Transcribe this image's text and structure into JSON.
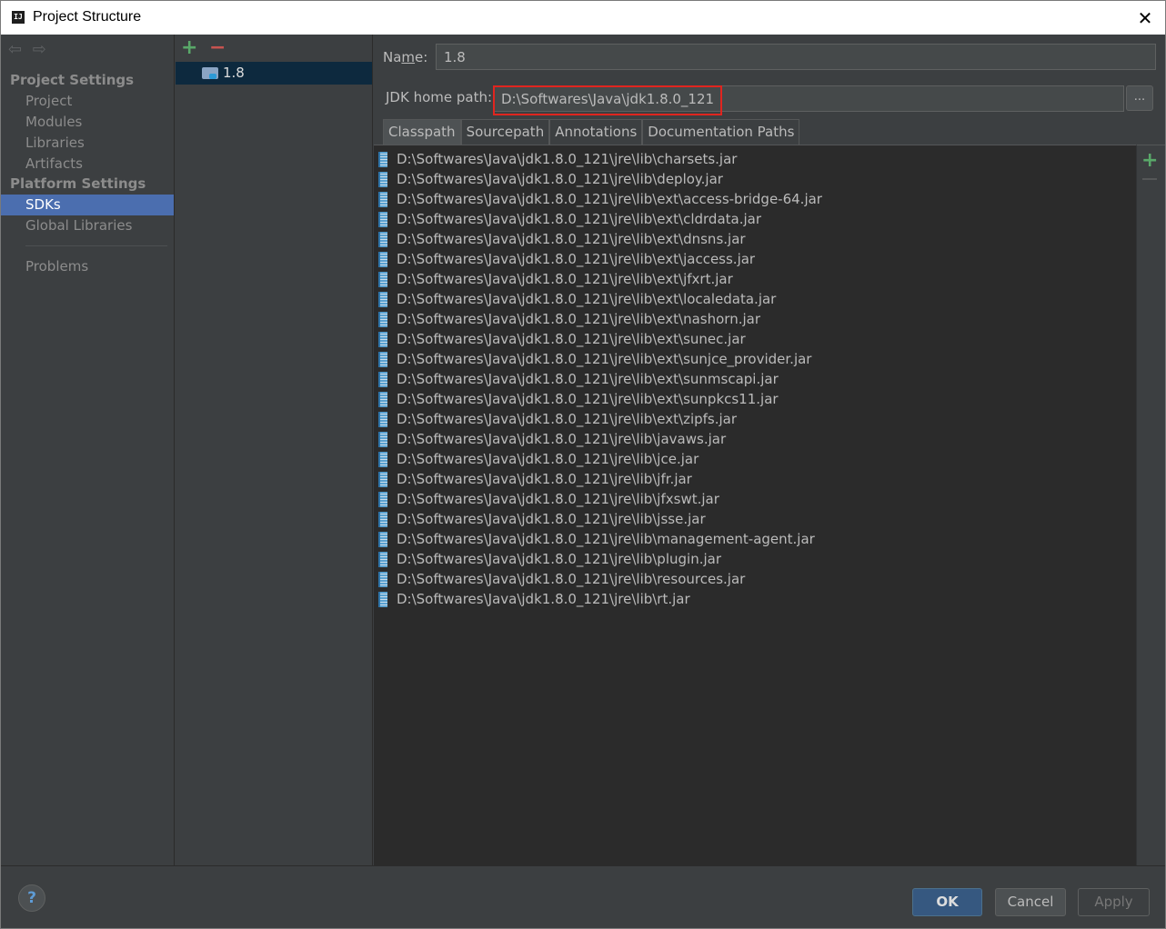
{
  "window": {
    "title": "Project Structure",
    "close_icon": "✕"
  },
  "nav": {
    "back_icon": "⇦",
    "forward_icon": "⇨",
    "sections": [
      {
        "label": "Project Settings",
        "items": [
          "Project",
          "Modules",
          "Libraries",
          "Artifacts"
        ]
      },
      {
        "label": "Platform Settings",
        "items": [
          "SDKs",
          "Global Libraries"
        ]
      }
    ],
    "problems": "Problems",
    "selected": "SDKs"
  },
  "sdk_list": {
    "add_icon": "+",
    "remove_icon": "−",
    "items": [
      "1.8"
    ]
  },
  "detail": {
    "name_label_pre": "Na",
    "name_label_mnemonic": "m",
    "name_label_post": "e:",
    "name_value": "1.8",
    "jdk_label": "JDK home path:",
    "jdk_value": "D:\\Softwares\\Java\\jdk1.8.0_121",
    "browse_label": "...",
    "tabs": [
      "Classpath",
      "Sourcepath",
      "Annotations",
      "Documentation Paths"
    ],
    "active_tab": "Classpath",
    "paths": [
      "D:\\Softwares\\Java\\jdk1.8.0_121\\jre\\lib\\charsets.jar",
      "D:\\Softwares\\Java\\jdk1.8.0_121\\jre\\lib\\deploy.jar",
      "D:\\Softwares\\Java\\jdk1.8.0_121\\jre\\lib\\ext\\access-bridge-64.jar",
      "D:\\Softwares\\Java\\jdk1.8.0_121\\jre\\lib\\ext\\cldrdata.jar",
      "D:\\Softwares\\Java\\jdk1.8.0_121\\jre\\lib\\ext\\dnsns.jar",
      "D:\\Softwares\\Java\\jdk1.8.0_121\\jre\\lib\\ext\\jaccess.jar",
      "D:\\Softwares\\Java\\jdk1.8.0_121\\jre\\lib\\ext\\jfxrt.jar",
      "D:\\Softwares\\Java\\jdk1.8.0_121\\jre\\lib\\ext\\localedata.jar",
      "D:\\Softwares\\Java\\jdk1.8.0_121\\jre\\lib\\ext\\nashorn.jar",
      "D:\\Softwares\\Java\\jdk1.8.0_121\\jre\\lib\\ext\\sunec.jar",
      "D:\\Softwares\\Java\\jdk1.8.0_121\\jre\\lib\\ext\\sunjce_provider.jar",
      "D:\\Softwares\\Java\\jdk1.8.0_121\\jre\\lib\\ext\\sunmscapi.jar",
      "D:\\Softwares\\Java\\jdk1.8.0_121\\jre\\lib\\ext\\sunpkcs11.jar",
      "D:\\Softwares\\Java\\jdk1.8.0_121\\jre\\lib\\ext\\zipfs.jar",
      "D:\\Softwares\\Java\\jdk1.8.0_121\\jre\\lib\\javaws.jar",
      "D:\\Softwares\\Java\\jdk1.8.0_121\\jre\\lib\\jce.jar",
      "D:\\Softwares\\Java\\jdk1.8.0_121\\jre\\lib\\jfr.jar",
      "D:\\Softwares\\Java\\jdk1.8.0_121\\jre\\lib\\jfxswt.jar",
      "D:\\Softwares\\Java\\jdk1.8.0_121\\jre\\lib\\jsse.jar",
      "D:\\Softwares\\Java\\jdk1.8.0_121\\jre\\lib\\management-agent.jar",
      "D:\\Softwares\\Java\\jdk1.8.0_121\\jre\\lib\\plugin.jar",
      "D:\\Softwares\\Java\\jdk1.8.0_121\\jre\\lib\\resources.jar",
      "D:\\Softwares\\Java\\jdk1.8.0_121\\jre\\lib\\rt.jar"
    ],
    "side_add_icon": "+"
  },
  "footer": {
    "help_label": "?",
    "ok_label": "OK",
    "cancel_label": "Cancel",
    "apply_label": "Apply"
  },
  "colors": {
    "background": "#3c3f41",
    "list_background": "#2b2b2b",
    "selection": "#4b6eaf",
    "highlight_border": "#e0251f",
    "add_green": "#59a869",
    "remove_red": "#c75450"
  }
}
